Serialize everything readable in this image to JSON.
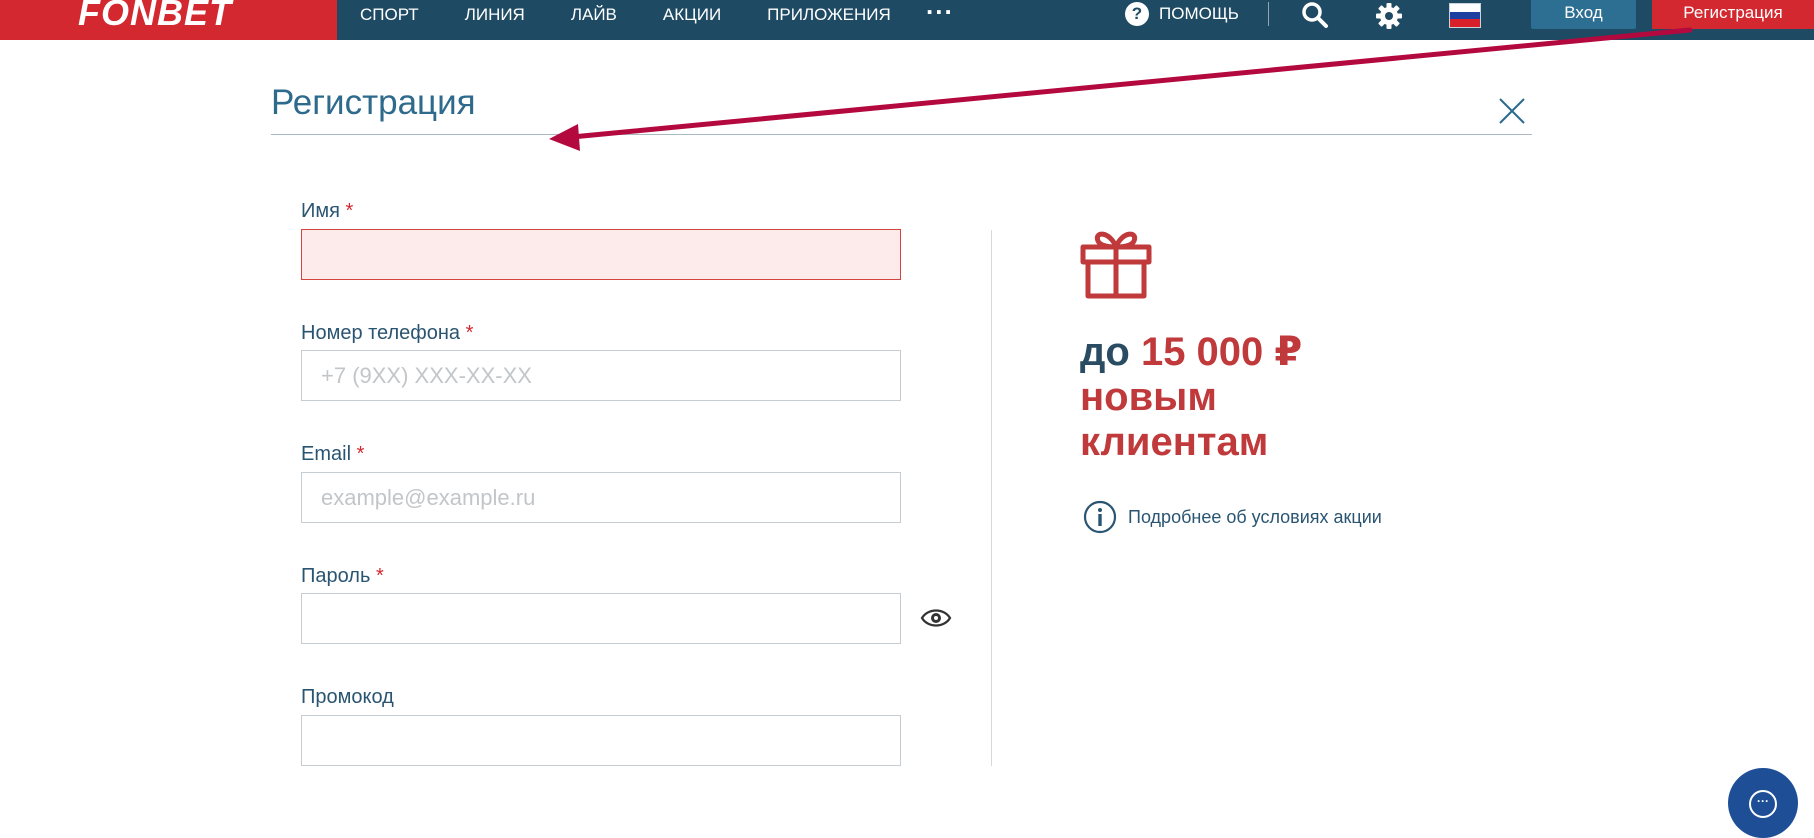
{
  "header": {
    "logo": "FONBET",
    "nav": [
      "СПОРТ",
      "ЛИНИЯ",
      "ЛАЙВ",
      "АКЦИИ",
      "ПРИЛОЖЕНИЯ"
    ],
    "more": "...",
    "help": "ПОМОЩЬ",
    "help_glyph": "?",
    "login": "Вход",
    "register": "Регистрация",
    "flag_colors": [
      "#ffffff",
      "#1c3fa0",
      "#d8202a"
    ]
  },
  "modal": {
    "title": "Регистрация",
    "fields": [
      {
        "label": "Имя",
        "required": "*",
        "placeholder": "",
        "error": true
      },
      {
        "label": "Номер телефона",
        "required": "*",
        "placeholder": "+7 (9XX) XXX-XX-XX"
      },
      {
        "label": "Email",
        "required": "*",
        "placeholder": "example@example.ru"
      },
      {
        "label": "Пароль",
        "required": "*",
        "placeholder": ""
      },
      {
        "label": "Промокод",
        "placeholder": ""
      }
    ]
  },
  "promo": {
    "prefix": "до",
    "amount": "15 000 ₽",
    "line2": "новым",
    "line3": "клиентам",
    "details": "Подробнее об условиях акции",
    "info_glyph": "i"
  },
  "chat": {
    "glyph": "···"
  },
  "colors": {
    "header_bg": "#1e4a63",
    "brand_red": "#d3282f",
    "accent_blue": "#2d6a8c",
    "promo_red": "#c0393b",
    "arrow": "#b3093f"
  }
}
